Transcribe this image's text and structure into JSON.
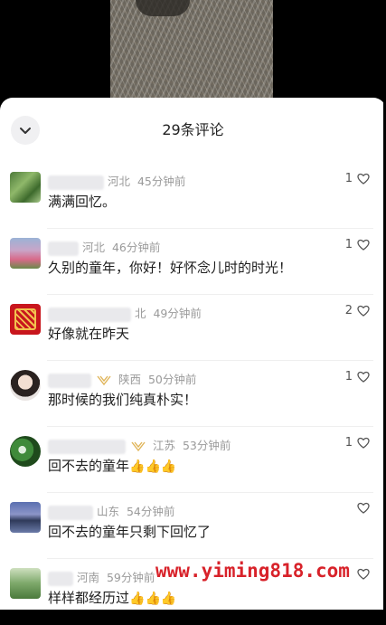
{
  "header": {
    "title": "29条评论"
  },
  "comments": [
    {
      "location": "河北",
      "time": "45分钟前",
      "text": "满满回忆。",
      "likes": "1"
    },
    {
      "location": "河北",
      "time": "46分钟前",
      "text": "久别的童年，你好！好怀念儿时的时光！",
      "likes": "1"
    },
    {
      "location": "北",
      "time": "49分钟前",
      "text": "好像就在昨天",
      "likes": "2"
    },
    {
      "location": "陕西",
      "time": "50分钟前",
      "text": "那时候的我们纯真朴实！",
      "likes": "1"
    },
    {
      "location": "江苏",
      "time": "53分钟前",
      "text": "回不去的童年",
      "likes": "1",
      "emoji": "👍👍👍"
    },
    {
      "location": "山东",
      "time": "54分钟前",
      "text": "回不去的童年只剩下回忆了",
      "likes": ""
    },
    {
      "location": "河南",
      "time": "59分钟前",
      "text": "样样都经历过",
      "likes": "",
      "emoji": "👍👍👍"
    }
  ],
  "watermark": "www.yiming818.com",
  "colors": {
    "watermark": "#d8222a",
    "meta_text": "#9a9a9a"
  }
}
